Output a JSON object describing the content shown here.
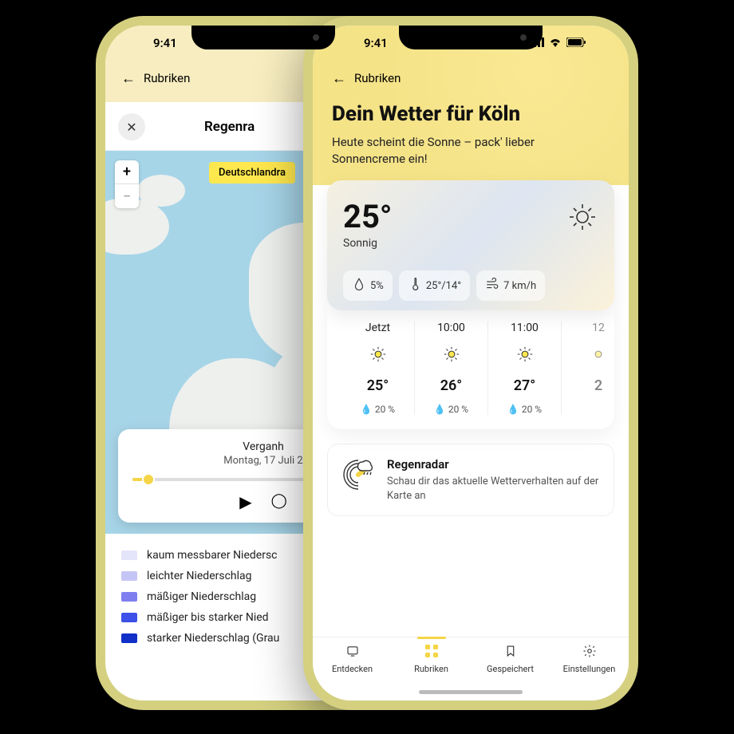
{
  "status_time": "9:41",
  "back_phone": {
    "nav_label": "Rubriken",
    "sheet_title": "Regenra",
    "map_tag": "Deutschlandra",
    "timeline": {
      "label": "Verganh",
      "date": "Montag, 17 Juli 2"
    },
    "legend": [
      {
        "color": "#e4e4fa",
        "label": "kaum messbarer Niedersc"
      },
      {
        "color": "#c5c5f5",
        "label": "leichter Niederschlag"
      },
      {
        "color": "#7f7ff0",
        "label": "mäßiger Niederschlag"
      },
      {
        "color": "#3d50e8",
        "label": "mäßiger bis starker Nied"
      },
      {
        "color": "#1030c8",
        "label": "starker Niederschlag (Grau"
      }
    ]
  },
  "front_phone": {
    "nav_label": "Rubriken",
    "title": "Dein Wetter für Köln",
    "subtitle": "Heute scheint die Sonne – pack' lieber Sonnencreme ein!",
    "current": {
      "temp": "25°",
      "condition": "Sonnig",
      "precip": "5%",
      "hilow": "25°/14°",
      "wind": "7 km/h"
    },
    "hourly": [
      {
        "time": "Jetzt",
        "temp": "25°",
        "precip": "20 %"
      },
      {
        "time": "10:00",
        "temp": "26°",
        "precip": "20 %"
      },
      {
        "time": "11:00",
        "temp": "27°",
        "precip": "20 %"
      },
      {
        "time": "12",
        "temp": "2",
        "precip": ""
      }
    ],
    "radar": {
      "title": "Regenradar",
      "sub": "Schau dir das aktuelle Wetterverhalten auf der Karte an"
    },
    "tabs": [
      {
        "label": "Entdecken"
      },
      {
        "label": "Rubriken"
      },
      {
        "label": "Gespeichert"
      },
      {
        "label": "Einstellungen"
      }
    ]
  }
}
